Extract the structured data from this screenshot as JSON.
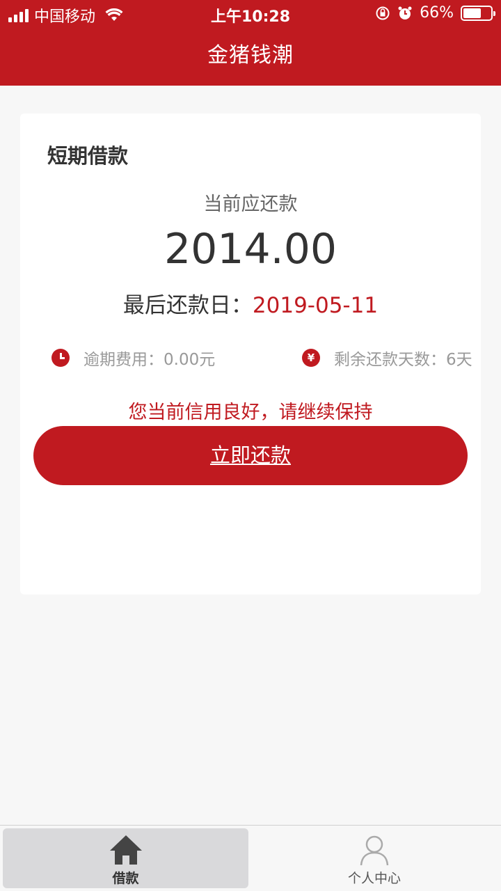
{
  "status_bar": {
    "carrier": "中国移动",
    "time": "上午10:28",
    "battery": "66%",
    "battery_level": 0.66,
    "icons": [
      "signal-icon",
      "wifi-icon",
      "rotation-lock-icon",
      "alarm-icon",
      "battery-icon"
    ]
  },
  "header": {
    "title": "金猪钱潮"
  },
  "loan_card": {
    "title": "短期借款",
    "current_due_label": "当前应还款",
    "amount": "2014.00",
    "due_date_label": "最后还款日：",
    "due_date": "2019-05-11",
    "overdue_fee": "逾期费用：0.00元",
    "days_left": "剩余还款天数：6天",
    "yen_symbol": "¥",
    "credit_message": "您当前信用良好，请继续保持",
    "pay_button": "立即还款"
  },
  "tabs": [
    {
      "label": "借款",
      "icon": "home-icon",
      "active": true
    },
    {
      "label": "个人中心",
      "icon": "user-icon",
      "active": false
    }
  ],
  "colors": {
    "brand": "#c01a20",
    "background": "#f7f7f7",
    "card": "#ffffff"
  }
}
